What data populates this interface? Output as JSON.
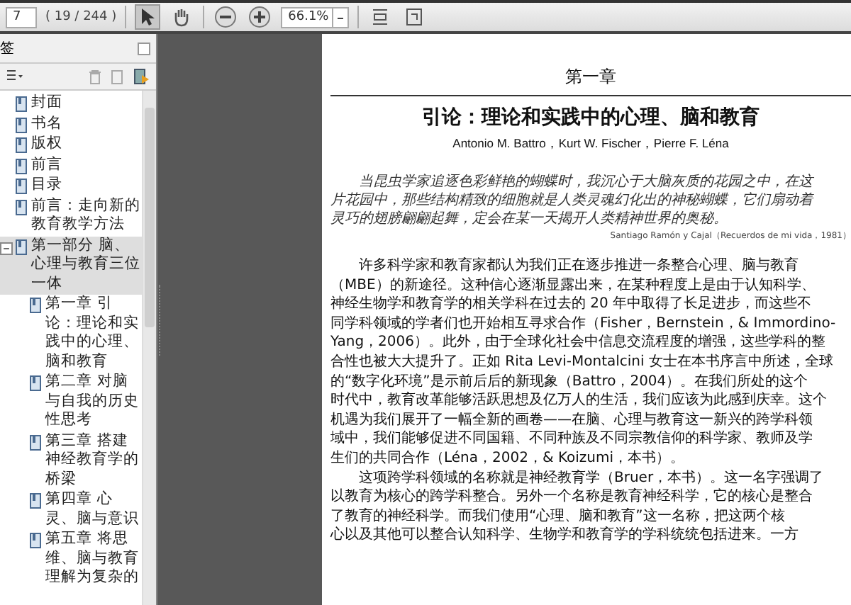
{
  "toolbar": {
    "page_number": "7",
    "page_count": "( 19 / 244 )",
    "zoom": "66.1%"
  },
  "sidebar": {
    "title": "签",
    "bookmarks": [
      {
        "label": "封面",
        "selected": false
      },
      {
        "label": "书名",
        "selected": false
      },
      {
        "label": "版权",
        "selected": false
      },
      {
        "label": "前言",
        "selected": false
      },
      {
        "label": "目录",
        "selected": false
      },
      {
        "label": "前言：走向新的教育教学方法",
        "selected": false
      },
      {
        "label": "第一部分 脑、心理与教育三位一体",
        "selected": true,
        "expanded": true,
        "children": [
          {
            "label": "第一章 引论：理论和实践中的心理、脑和教育",
            "selected": false
          },
          {
            "label": "第二章 对脑与自我的历史性思考",
            "selected": false
          },
          {
            "label": "第三章 搭建神经教育学的桥梁",
            "selected": false
          },
          {
            "label": "第四章 心灵、脑与意识",
            "selected": false
          },
          {
            "label": "第五章 将思维、脑与教育理解为复杂的",
            "selected": false
          }
        ]
      }
    ]
  },
  "document": {
    "chapter": "第一章",
    "title": "引论：理论和实践中的心理、脑和教育",
    "authors": "Antonio M. Battro，Kurt W. Fischer，Pierre F. Léna",
    "epigraph": [
      "当昆虫学家追逐色彩鲜艳的蝴蝶时，我沉心于大脑灰质的花园之中，在这",
      "片花园中，那些结构精致的细胞就是人类灵魂幻化出的神秘蝴蝶，它们扇动着",
      "灵巧的翅膀翩翩起舞，定会在某一天揭开人类精神世界的奥秘。"
    ],
    "attribution": "Santiago Ramón y Cajal（Recuerdos de mi vida，1981）",
    "paragraphs": [
      [
        "许多科学家和教育家都认为我们正在逐步推进一条整合心理、脑与教育",
        "（MBE）的新途径。这种信心逐渐显露出来，在某种程度上是由于认知科学、",
        "神经生物学和教育学的相关学科在过去的 20 年中取得了长足进步，而这些不",
        "同学科领域的学者们也开始相互寻求合作（Fisher，Bernstein，& Immordino-",
        "Yang，2006）。此外，由于全球化社会中信息交流程度的增强，这些学科的整",
        "合性也被大大提升了。正如 Rita Levi-Montalcini 女士在本书序言中所述，全球",
        "的“数字化环境”是示前后后的新现象（Battro，2004）。在我们所处的这个",
        "时代中，教育改革能够活跃思想及亿万人的生活，我们应该为此感到庆幸。这个",
        "机遇为我们展开了一幅全新的画卷——在脑、心理与教育这一新兴的跨学科领",
        "域中，我们能够促进不同国籍、不同种族及不同宗教信仰的科学家、教师及学",
        "生们的共同合作（Léna，2002，& Koizumi，本书）。"
      ],
      [
        "这项跨学科领域的名称就是神经教育学（Bruer，本书）。这一名字强调了",
        "以教育为核心的跨学科整合。另外一个名称是教育神经科学，它的核心是整合",
        "了教育的神经科学。而我们使用“心理、脑和教育”这一名称，把这两个核",
        "心以及其他可以整合认知科学、生物学和教育学的学科统统包括进来。一方"
      ]
    ]
  }
}
